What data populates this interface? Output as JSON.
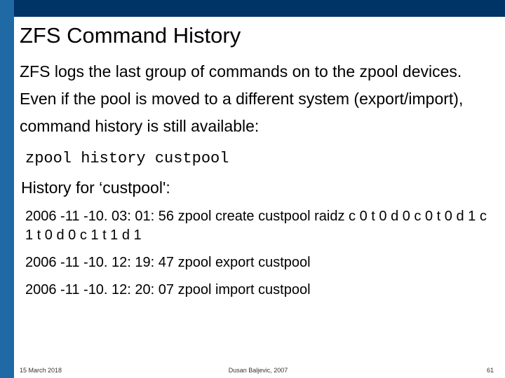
{
  "title": "ZFS Command History",
  "intro": "ZFS logs the last group of commands on to the zpool devices. Even if the pool is moved to a different system (export/import), command history is still available:",
  "command": "zpool history custpool",
  "subhead": "History for ‘custpool':",
  "history": [
    "2006 -11 -10. 03: 01: 56 zpool create custpool raidz c 0 t 0 d 0 c 0 t 0 d 1 c 1 t 0 d 0 c 1 t 1 d 1",
    "2006 -11 -10. 12: 19: 47 zpool export custpool",
    "2006 -11 -10. 12: 20: 07 zpool import custpool"
  ],
  "footer": {
    "date": "15 March 2018",
    "author": "Dusan Baljevic, 2007",
    "page": "61"
  }
}
